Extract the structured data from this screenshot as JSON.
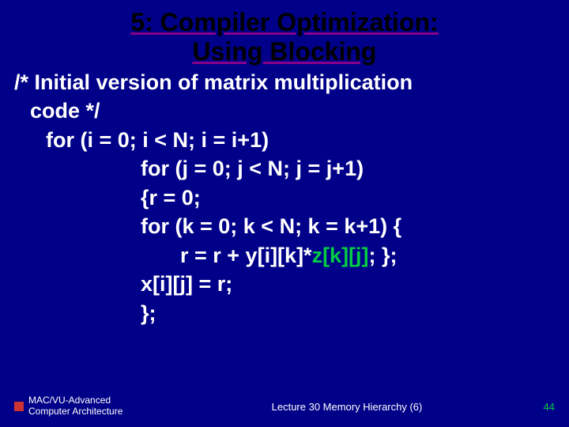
{
  "title": {
    "line1": "5: Compiler Optimization:",
    "line2": "Using Blocking"
  },
  "code": {
    "comment1": "/* Initial version of matrix multiplication",
    "comment2": "code */",
    "for_i": "for (i = 0; i < N; i = i+1)",
    "for_j": "for (j = 0; j < N; j = j+1)",
    "r_init": "{r = 0;",
    "for_k": "for (k = 0; k < N; k = k+1) {",
    "r_calc_prefix": "r = r + y[i][k]*",
    "r_calc_zkj": "z[k][j]",
    "r_calc_suffix": ";   };",
    "x_assign": "x[i][j] = r;",
    "close": "};"
  },
  "footer": {
    "left_line1": "MAC/VU-Advanced",
    "left_line2": "Computer Architecture",
    "center": "Lecture 30 Memory Hierarchy (6)",
    "page": "44"
  }
}
